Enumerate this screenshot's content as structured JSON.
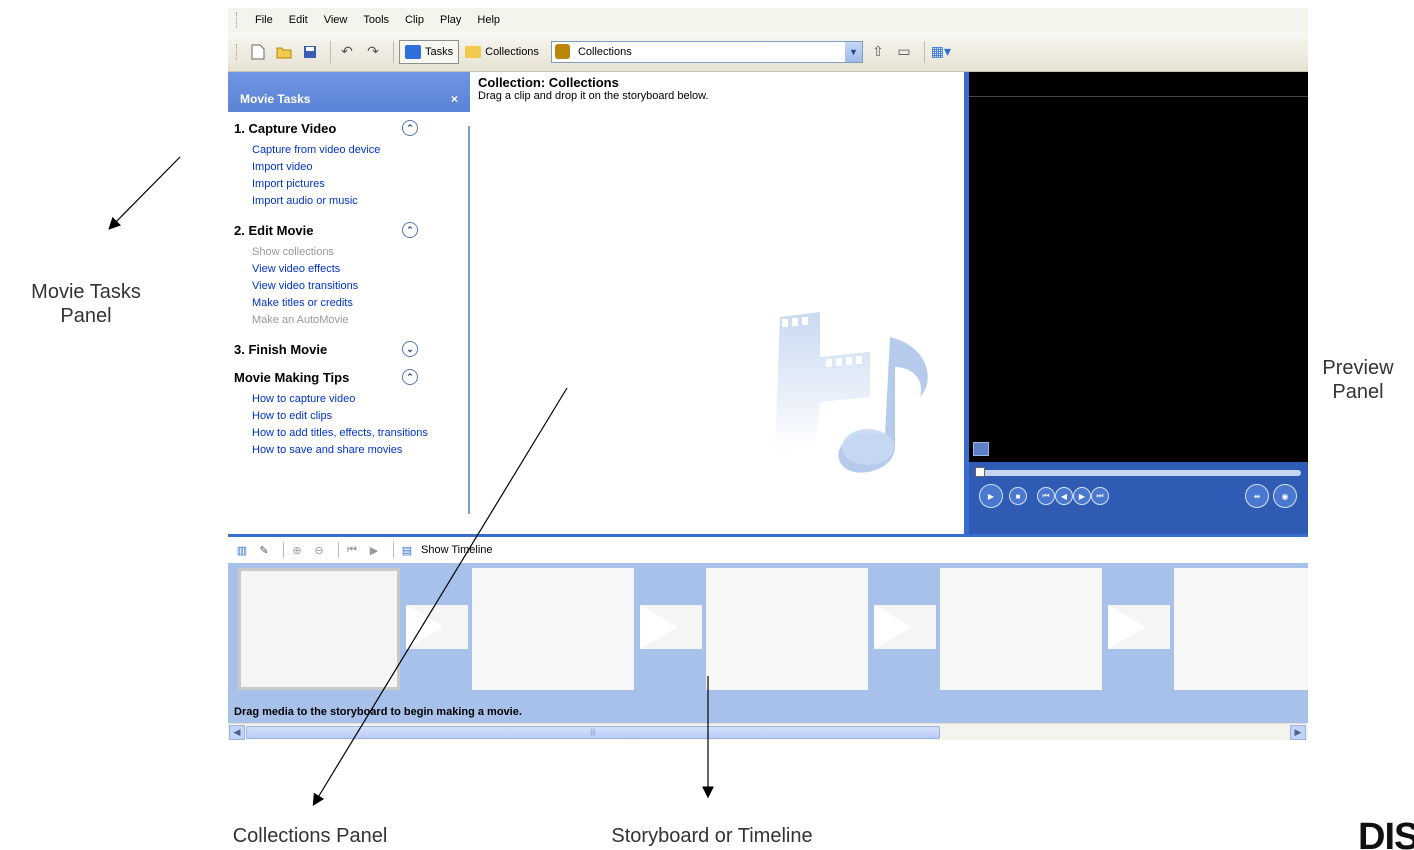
{
  "menu": [
    "File",
    "Edit",
    "View",
    "Tools",
    "Clip",
    "Play",
    "Help"
  ],
  "toolbar": {
    "tasks_label": "Tasks",
    "collections_label": "Collections",
    "collections_combo_value": "Collections"
  },
  "tasks_panel": {
    "header": "Movie Tasks",
    "close": "×",
    "sections": [
      {
        "title": "1. Capture Video",
        "toggle": "⌃",
        "links": [
          {
            "label": "Capture from video device",
            "enabled": true
          },
          {
            "label": "Import video",
            "enabled": true
          },
          {
            "label": "Import pictures",
            "enabled": true
          },
          {
            "label": "Import audio or music",
            "enabled": true
          }
        ]
      },
      {
        "title": "2. Edit Movie",
        "toggle": "⌃",
        "links": [
          {
            "label": "Show collections",
            "enabled": false
          },
          {
            "label": "View video effects",
            "enabled": true
          },
          {
            "label": "View video transitions",
            "enabled": true
          },
          {
            "label": "Make titles or credits",
            "enabled": true
          },
          {
            "label": "Make an AutoMovie",
            "enabled": false
          }
        ]
      },
      {
        "title": "3. Finish Movie",
        "toggle": "⌄",
        "links": []
      },
      {
        "title": "Movie Making Tips",
        "toggle": "⌃",
        "links": [
          {
            "label": "How to capture video",
            "enabled": true
          },
          {
            "label": "How to edit clips",
            "enabled": true
          },
          {
            "label": "How to add titles, effects, transitions",
            "enabled": true
          },
          {
            "label": "How to save and share movies",
            "enabled": true
          }
        ]
      }
    ]
  },
  "collection": {
    "title": "Collection: Collections",
    "subtitle": "Drag a clip and drop it on the storyboard below."
  },
  "storyboard": {
    "show_timeline_label": "Show Timeline",
    "message": "Drag media to the storyboard to begin making a movie."
  },
  "annotations": {
    "movie_tasks_line1": "Movie Tasks",
    "movie_tasks_line2": "Panel",
    "preview_line1": "Preview",
    "preview_line2": "Panel",
    "collections": "Collections Panel",
    "storyboard": "Storyboard or Timeline"
  },
  "logo_text": "DISCO",
  "colors": {
    "accent_blue": "#3A6DD0",
    "storyboard_bg": "#A8C1EA",
    "link_blue": "#0033CC"
  }
}
